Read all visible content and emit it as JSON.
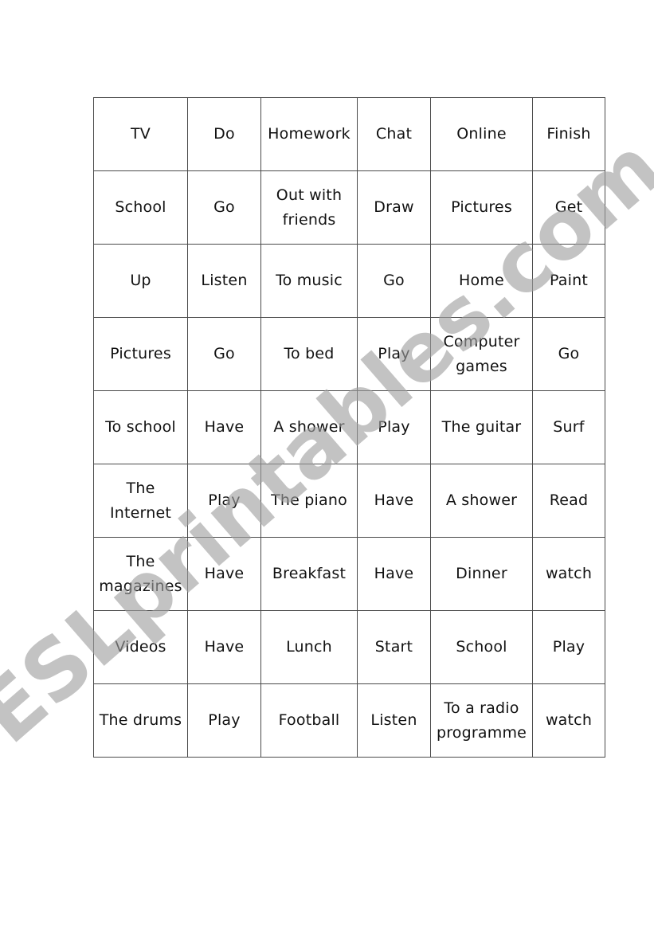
{
  "worksheet": {
    "rows": [
      [
        "TV",
        "Do",
        "Homework",
        "Chat",
        "Online",
        "Finish"
      ],
      [
        "School",
        "Go",
        "Out with friends",
        "Draw",
        "Pictures",
        "Get"
      ],
      [
        "Up",
        "Listen",
        "To music",
        "Go",
        "Home",
        "Paint"
      ],
      [
        "Pictures",
        "Go",
        "To bed",
        "Play",
        "Computer games",
        "Go"
      ],
      [
        "To school",
        "Have",
        "A shower",
        "Play",
        "The guitar",
        "Surf"
      ],
      [
        "The Internet",
        "Play",
        "The piano",
        "Have",
        "A shower",
        "Read"
      ],
      [
        "The magazines",
        "Have",
        "Breakfast",
        "Have",
        "Dinner",
        "watch"
      ],
      [
        "Videos",
        "Have",
        "Lunch",
        "Start",
        "School",
        "Play"
      ],
      [
        "The drums",
        "Play",
        "Football",
        "Listen",
        "To a radio programme",
        "watch"
      ]
    ]
  },
  "watermark": {
    "text": "ESLprintables.com",
    "color": "#9e9e9e"
  }
}
